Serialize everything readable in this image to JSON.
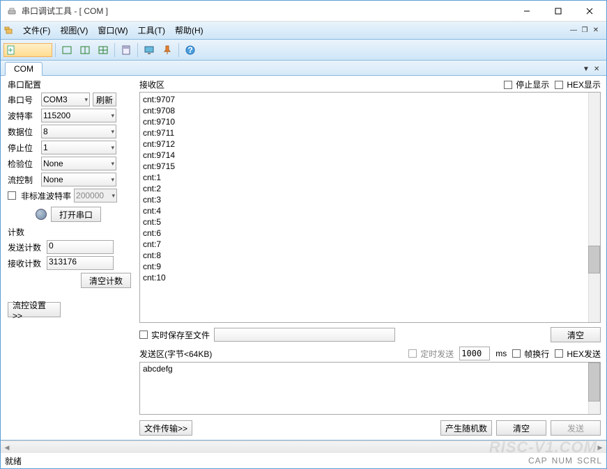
{
  "window": {
    "title": "串口调试工具 - [ COM ]"
  },
  "menu": {
    "file": "文件(F)",
    "view": "视图(V)",
    "window": "窗口(W)",
    "tool": "工具(T)",
    "help": "帮助(H)"
  },
  "tabs": {
    "com": "COM"
  },
  "serial_config": {
    "title": "串口配置",
    "port_label": "串口号",
    "port_value": "COM3",
    "refresh": "刷新",
    "baud_label": "波特率",
    "baud_value": "115200",
    "data_label": "数据位",
    "data_value": "8",
    "stop_label": "停止位",
    "stop_value": "1",
    "parity_label": "检验位",
    "parity_value": "None",
    "flow_label": "流控制",
    "flow_value": "None",
    "nonstd_label": "非标准波特率",
    "nonstd_value": "200000",
    "open_port": "打开串口"
  },
  "counter": {
    "title": "计数",
    "send_label": "发送计数",
    "send_value": "0",
    "recv_label": "接收计数",
    "recv_value": "313176",
    "clear": "清空计数"
  },
  "flowctl_btn": "流控设置>>",
  "rx": {
    "title": "接收区",
    "stop_display": "停止显示",
    "hex_display": "HEX显示",
    "lines": [
      "cnt:9707",
      "cnt:9708",
      "cnt:9710",
      "cnt:9711",
      "cnt:9712",
      "cnt:9714",
      "cnt:9715",
      "cnt:1",
      "cnt:2",
      "cnt:3",
      "cnt:4",
      "cnt:5",
      "cnt:6",
      "cnt:7",
      "cnt:8",
      "cnt:9",
      "cnt:10"
    ]
  },
  "save_file": {
    "label": "实时保存至文件",
    "clear": "清空",
    "path": ""
  },
  "tx": {
    "title": "发送区(字节<64KB)",
    "timed_label": "定时发送",
    "timed_value": "1000",
    "timed_unit": "ms",
    "linewrap": "帧换行",
    "hex_send": "HEX发送",
    "content": "abcdefg",
    "file_transfer": "文件传输>>",
    "gen_random": "产生随机数",
    "clear": "清空",
    "send": "发送"
  },
  "status": {
    "ready": "就绪",
    "caps": "CAP",
    "num": "NUM",
    "scrl": "SCRL"
  },
  "watermark": "RISC-V1.COM"
}
